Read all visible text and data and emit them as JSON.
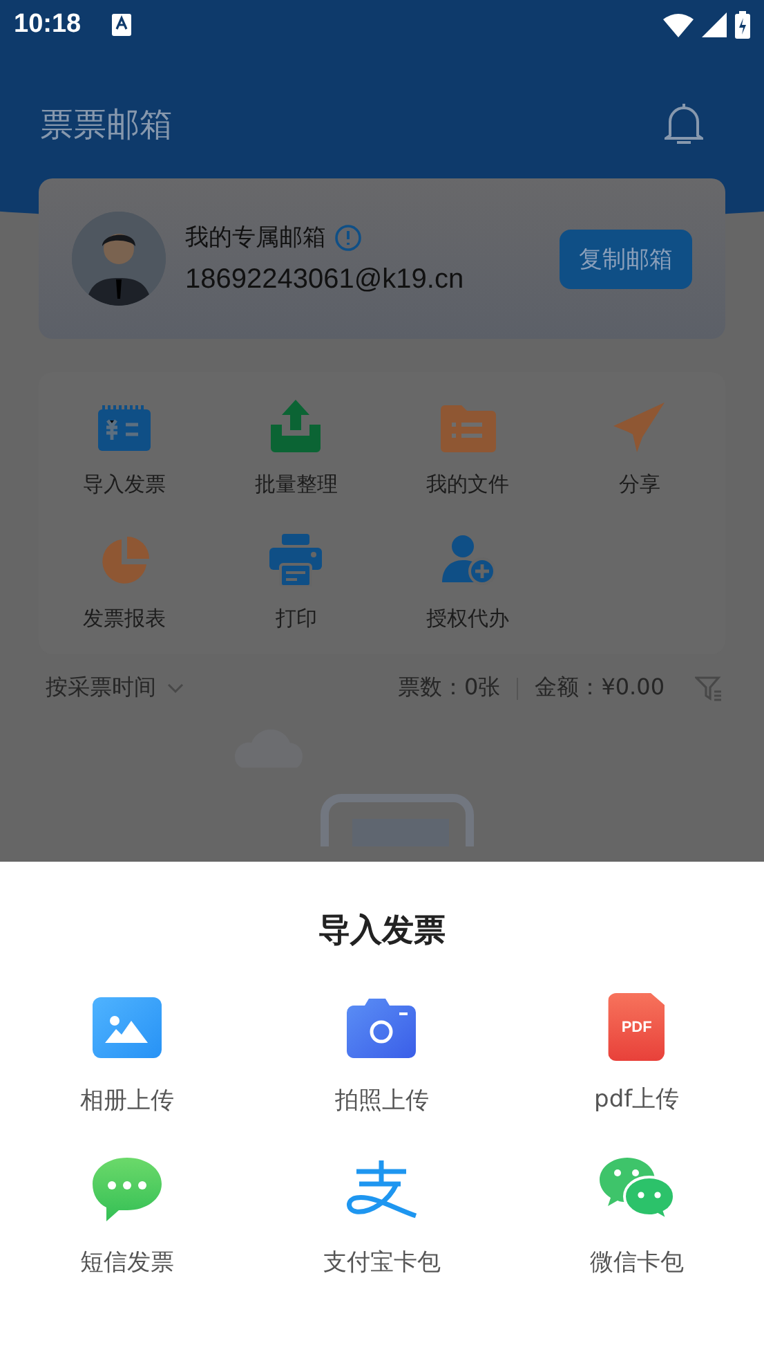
{
  "status_bar": {
    "time": "10:18"
  },
  "header": {
    "title": "票票邮箱"
  },
  "account": {
    "label": "我的专属邮箱",
    "email": "18692243061@k19.cn",
    "button": "复制邮箱"
  },
  "features": [
    {
      "label": "导入发票",
      "kind": "invoice"
    },
    {
      "label": "批量整理",
      "kind": "upload"
    },
    {
      "label": "我的文件",
      "kind": "folder"
    },
    {
      "label": "分享",
      "kind": "send"
    },
    {
      "label": "发票报表",
      "kind": "pie"
    },
    {
      "label": "打印",
      "kind": "printer"
    },
    {
      "label": "授权代办",
      "kind": "user-add"
    }
  ],
  "filter_bar": {
    "sort": "按采票时间",
    "count": "票数：0张",
    "amount": "金额：¥0.00"
  },
  "sheet": {
    "title": "导入发票",
    "options": [
      {
        "label": "相册上传",
        "kind": "album"
      },
      {
        "label": "拍照上传",
        "kind": "camera"
      },
      {
        "label": "pdf上传",
        "kind": "pdf",
        "badge": "PDF"
      },
      {
        "label": "短信发票",
        "kind": "sms"
      },
      {
        "label": "支付宝卡包",
        "kind": "alipay"
      },
      {
        "label": "微信卡包",
        "kind": "wechat"
      }
    ]
  }
}
